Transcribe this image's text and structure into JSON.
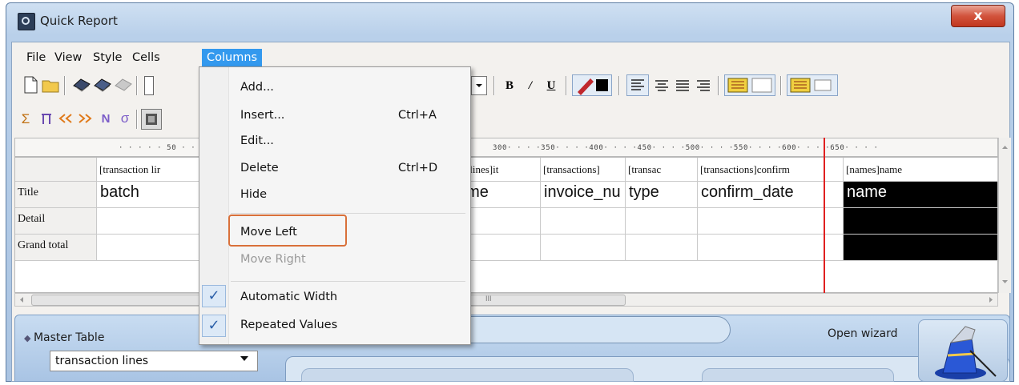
{
  "window": {
    "title": "Quick Report",
    "close_glyph": "x"
  },
  "menubar": [
    "File",
    "View",
    "Style",
    "Cells",
    "Columns"
  ],
  "toolbar_icons": [
    "new-icon",
    "open-icon",
    "print-preview-icon",
    "print-icon",
    "page-setup-icon",
    "sum-icon",
    "count-icon",
    "min-icon",
    "max-icon",
    "n-icon",
    "sigma-icon",
    "field-icon",
    "dropdown-icon",
    "bold-icon",
    "italic-icon",
    "underline-icon",
    "pen-color-icon",
    "align-left-icon",
    "align-center-icon",
    "align-justify-icon",
    "align-right-icon",
    "fill-color-icon",
    "border-color-icon"
  ],
  "toolbar": {
    "bold": "B",
    "italic": "/",
    "underline": "U",
    "sum": "Σ",
    "n": "N",
    "sigma": "σ"
  },
  "ruler": {
    "left": "· · · · · 50 · · ·",
    "right": "300· · · ·350· · · ·400· · · ·450· · · ·500· · · ·550· · · ·600· · · ·650· · · ·"
  },
  "grid": {
    "columns": [
      "[transaction lir",
      "on lines]it",
      "[transactions]",
      "[transac",
      "[transactions]confirm",
      "[names]name"
    ],
    "rows": [
      "Title",
      "Detail",
      "Grand total"
    ],
    "title_values": [
      "batch",
      "ame",
      "invoice_nu",
      "type",
      "confirm_date",
      "name"
    ]
  },
  "hscroll_thumb": "III",
  "dropdown": {
    "items": [
      {
        "label": "Add...",
        "shortcut": ""
      },
      {
        "label": "Insert...",
        "shortcut": "Ctrl+A"
      },
      {
        "label": "Edit...",
        "shortcut": ""
      },
      {
        "label": "Delete",
        "shortcut": "Ctrl+D"
      },
      {
        "label": "Hide",
        "shortcut": ""
      },
      {
        "label": "Move Left",
        "shortcut": ""
      },
      {
        "label": "Move Right",
        "shortcut": ""
      },
      {
        "label": "Automatic Width",
        "shortcut": "",
        "checked": true
      },
      {
        "label": "Repeated Values",
        "shortcut": "",
        "checked": true
      }
    ]
  },
  "bottom": {
    "master_label": "Master Table",
    "master_value": "transaction lines",
    "open_wizard": "Open wizard"
  },
  "colors": {
    "highlight": "#3399ee",
    "callout": "#d9703a",
    "marker": "#e02020"
  }
}
